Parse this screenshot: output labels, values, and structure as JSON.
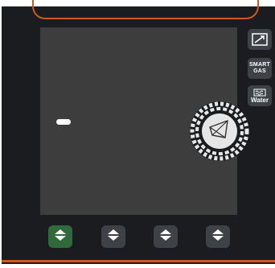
{
  "colors": {
    "frame": "#1a1c1f",
    "screen": "#3d3d3d",
    "accent": "#d0571f",
    "button": "#3e4146",
    "active_button": "#2f6a3b"
  },
  "side_buttons": [
    {
      "icon": "trend-arrow-icon",
      "label": ""
    },
    {
      "icon": "",
      "label_line1": "SMART",
      "label_line2": "GAS"
    },
    {
      "icon": "water-waves-icon",
      "label": "Water"
    }
  ],
  "knob": {
    "icon": "nozzle-icon"
  },
  "bottom_buttons": [
    {
      "icon": "up-down-arrows-icon",
      "active": true
    },
    {
      "icon": "up-down-arrows-icon",
      "active": false
    },
    {
      "icon": "up-down-arrows-icon",
      "active": false
    },
    {
      "icon": "up-down-arrows-icon",
      "active": false
    }
  ]
}
